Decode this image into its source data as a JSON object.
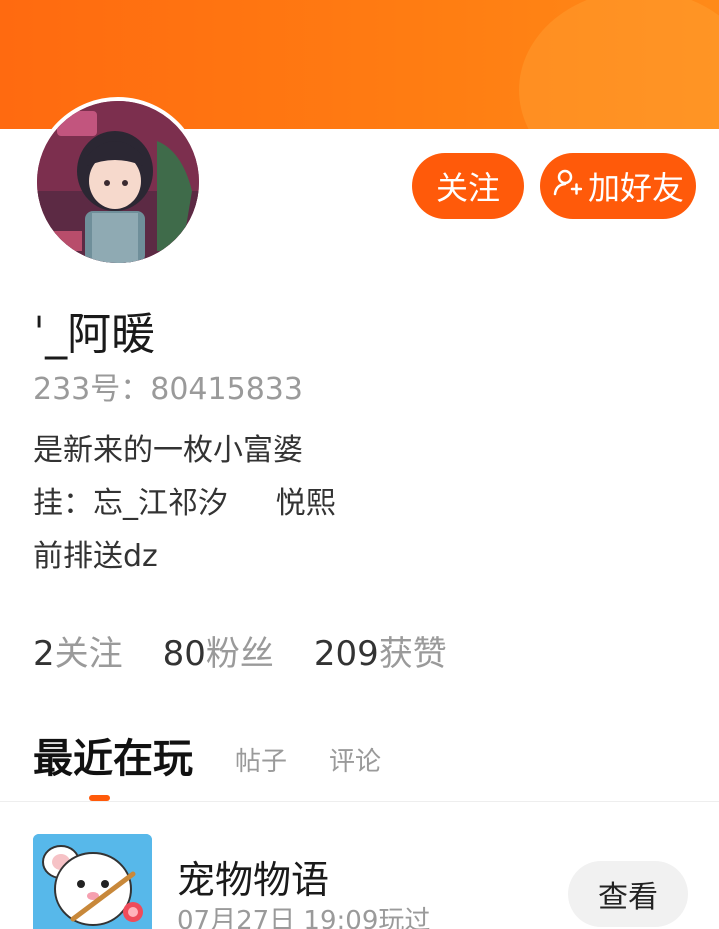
{
  "profile": {
    "username": "ˈ_阿暖",
    "uid_text": "233号：80415833",
    "bio": "是新来的一枚小富婆\n挂：忘_江祁汐     悦熙\n前排送dz"
  },
  "actions": {
    "follow_label": "关注",
    "add_friend_label": "加好友"
  },
  "stats": [
    {
      "num": "2",
      "label": "关注"
    },
    {
      "num": "80",
      "label": "粉丝"
    },
    {
      "num": "209",
      "label": "获赞"
    }
  ],
  "tabs": {
    "active": "最近在玩",
    "posts": "帖子",
    "comments": "评论"
  },
  "recent_game": {
    "name": "宠物物语",
    "time": "07月27日 19:09玩过",
    "view_label": "查看"
  },
  "colors": {
    "accent": "#ff5a0a",
    "banner": "#ff7d12"
  }
}
